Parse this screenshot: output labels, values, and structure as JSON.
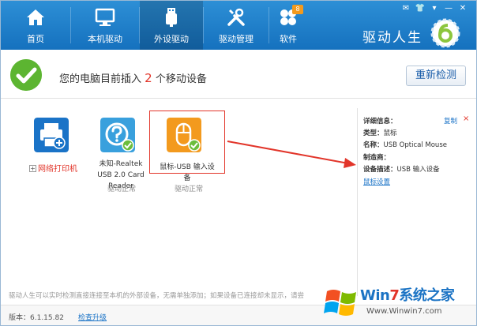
{
  "nav": {
    "items": [
      {
        "label": "首页",
        "icon": "home-icon"
      },
      {
        "label": "本机驱动",
        "icon": "monitor-icon"
      },
      {
        "label": "外设驱动",
        "icon": "usb-icon"
      },
      {
        "label": "驱动管理",
        "icon": "tools-icon"
      },
      {
        "label": "软件",
        "icon": "apps-icon"
      }
    ],
    "software_badge": "8"
  },
  "brand": {
    "name": "驱动人生"
  },
  "status": {
    "prefix": "您的电脑目前插入",
    "count": "2",
    "suffix": "个移动设备",
    "rescan_label": "重新检测"
  },
  "devices": [
    {
      "label": "网络打印机",
      "icon": "printer-icon"
    },
    {
      "label": "未知-Realtek USB 2.0 Card Reader",
      "status": "驱动正常",
      "icon": "help-icon"
    },
    {
      "label": "鼠标-USB 输入设备",
      "status": "驱动正常",
      "icon": "mouse-icon"
    }
  ],
  "details": {
    "header": "详细信息：",
    "copy": "复制",
    "close": "×",
    "type_label": "类型：",
    "type_value": "鼠标",
    "name_label": "名称：",
    "name_value": "USB Optical Mouse",
    "maker_label": "制造商：",
    "desc_label": "设备描述：",
    "desc_value": "USB 输入设备",
    "mouse_settings": "鼠标设置"
  },
  "hint": "驱动人生可以实时检测直接连接至本机的外部设备，无需单独添加；如果设备已连接却未显示，请尝",
  "footer": {
    "version": "版本：6.1.15.82",
    "check_update": "检查升级"
  },
  "watermark": {
    "win": "Win",
    "seven": "7",
    "rest": "系统之家",
    "url": "Www.Winwin7.com"
  },
  "colors": {
    "header": "#1e80cc",
    "accent_red": "#e2352a",
    "ok_green": "#5cb531",
    "orange": "#f39a1e"
  }
}
